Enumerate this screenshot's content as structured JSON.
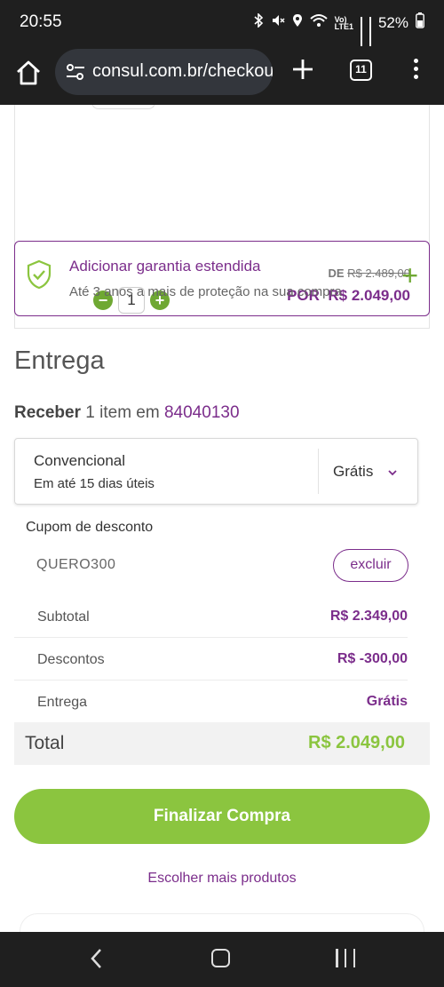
{
  "status_bar": {
    "time": "20:55",
    "battery": "52%",
    "icons": [
      "bluetooth-icon",
      "mute-icon",
      "location-icon",
      "wifi-icon",
      "volte-icon",
      "signal-icon",
      "signal-icon",
      "battery-icon"
    ]
  },
  "browser": {
    "url": "consul.com.br/checkout",
    "tab_count": "11",
    "icons": [
      "home-icon",
      "site-settings-icon",
      "plus-icon",
      "tabs-icon",
      "overflow-menu-icon"
    ]
  },
  "product": {
    "quantity": "1",
    "price_old_prefix": "DE",
    "price_old": "R$ 2.489,00",
    "price_new_prefix": "POR",
    "price_new": "R$ 2.049,00"
  },
  "warranty": {
    "title": "Adicionar garantia estendida",
    "subtitle": "Até 3 anos a mais de proteção na sua compra"
  },
  "delivery": {
    "section_title": "Entrega",
    "receive_label": "Receber",
    "receive_text": "1 item em",
    "zip": "84040130",
    "option_name": "Convencional",
    "option_time": "Em até 15 dias úteis",
    "option_price": "Grátis"
  },
  "coupon": {
    "label": "Cupom de desconto",
    "code": "QUERO300",
    "remove_label": "excluir"
  },
  "summary": {
    "subtotal_label": "Subtotal",
    "subtotal_value": "R$ 2.349,00",
    "discount_label": "Descontos",
    "discount_value": "R$ -300,00",
    "shipping_label": "Entrega",
    "shipping_value": "Grátis",
    "total_label": "Total",
    "total_value": "R$ 2.049,00"
  },
  "actions": {
    "checkout_label": "Finalizar Compra",
    "continue_label": "Escolher mais produtos"
  },
  "colors": {
    "brand_purple": "#7b2d8b",
    "brand_green": "#8bc53f",
    "dark_bar": "#1f1f1f"
  }
}
